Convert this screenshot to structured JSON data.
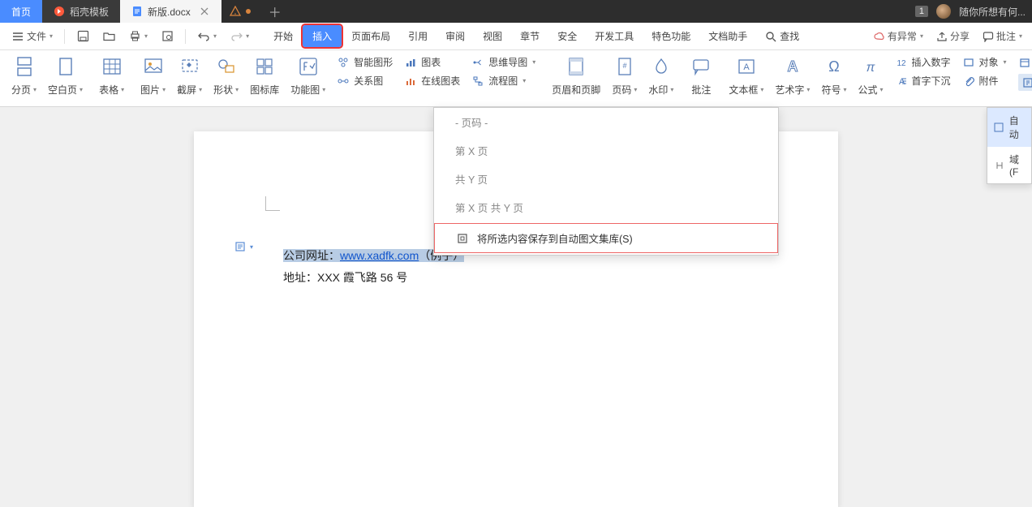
{
  "tabs": {
    "home": "首页",
    "template": "稻壳模板",
    "doc": "新版.docx",
    "badge": "1",
    "user_hint": "随你所想有何..."
  },
  "quick": {
    "file": "文件"
  },
  "menu": {
    "start": "开始",
    "insert": "插入",
    "pagelayout": "页面布局",
    "reference": "引用",
    "review": "审阅",
    "view": "视图",
    "chapter": "章节",
    "security": "安全",
    "devtools": "开发工具",
    "special": "特色功能",
    "dochelper": "文档助手",
    "search": "查找"
  },
  "right_tools": {
    "sync": "有异常",
    "share": "分享",
    "batch": "批注"
  },
  "ribbon": {
    "paging": "分页",
    "blankpage": "空白页",
    "table": "表格",
    "picture": "图片",
    "screenshot": "截屏",
    "shape": "形状",
    "iconlib": "图标库",
    "funcimg": "功能图",
    "smartshape": "智能图形",
    "chart": "图表",
    "mindmap": "思维导图",
    "relationchart": "关系图",
    "onlinechart": "在线图表",
    "flowchart": "流程图",
    "headerfooter": "页眉和页脚",
    "pagenumber": "页码",
    "watermark": "水印",
    "comment": "批注",
    "textbox": "文本框",
    "wordart": "艺术字",
    "symbol": "符号",
    "formula": "公式",
    "insertnumber": "插入数字",
    "dropcap": "首字下沉",
    "object": "对象",
    "attachment": "附件",
    "date": "日期",
    "docparts": "文档部"
  },
  "dropdown": {
    "pagenum_header": "- 页码 -",
    "page_x": "第 X 页",
    "total_y": "共 Y 页",
    "page_x_of_y": "第 X 页 共 Y 页",
    "save_to_autotext": "将所选内容保存到自动图文集库(S)"
  },
  "side_popup": {
    "auto": "自动",
    "field": "域(F"
  },
  "document": {
    "line1_label": "公司网址：",
    "line1_link": "www.xadfk.com",
    "line1_suffix": "（例子）",
    "line2": "地址：XXX 霞飞路 56 号"
  }
}
